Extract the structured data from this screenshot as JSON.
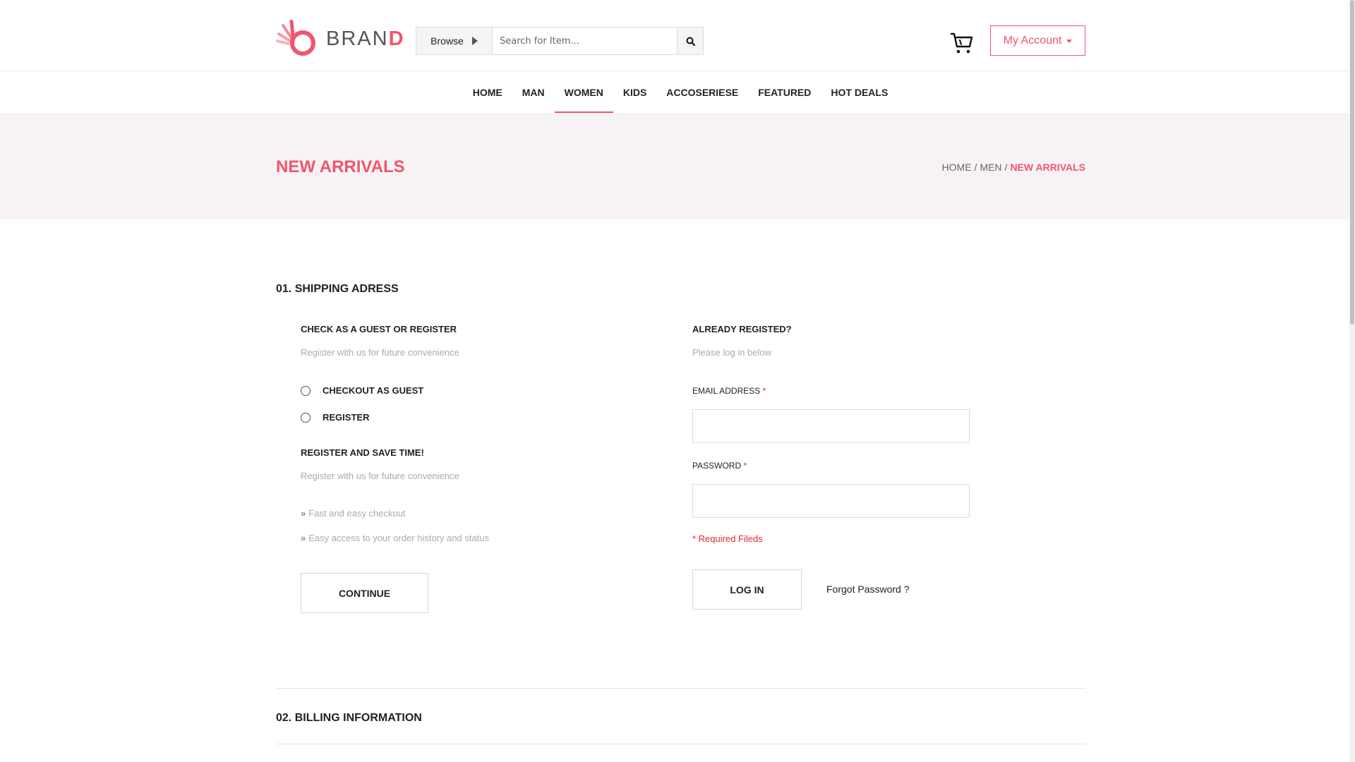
{
  "header": {
    "logo_text_main": "BRAN",
    "logo_text_accent": "D",
    "browse_label": "Browse",
    "search_placeholder": "Search for Item...",
    "account_label": "My Account"
  },
  "nav": {
    "items": [
      "HOME",
      "MAN",
      "WOMEN",
      "KIDS",
      "ACCOSERIESE",
      "FEATURED",
      "HOT DEALS"
    ],
    "active": "WOMEN"
  },
  "banner": {
    "title": "NEW ARRIVALS",
    "breadcrumb": [
      "HOME",
      "MEN",
      "NEW ARRIVALS"
    ]
  },
  "shipping": {
    "section_title": "01. SHIPPING ADRESS",
    "guest": {
      "heading": "CHECK AS A GUEST OR REGISTER",
      "subtext": "Register with us for future convenience",
      "options": [
        "CHECKOUT AS GUEST",
        "REGISTER"
      ],
      "register_heading": "REGISTER AND SAVE TIME!",
      "register_subtext": "Register with us for future convenience",
      "benefits": [
        "Fast and easy checkout",
        "Easy access to your order history and status"
      ],
      "continue_label": "CONTINUE"
    },
    "login": {
      "heading": "ALREADY REGISTED?",
      "subtext": "Please log in below",
      "email_label": "EMAIL ADDRESS",
      "password_label": "PASSWORD",
      "required_mark": "*",
      "required_note": "* Required Fileds",
      "login_label": "LOG IN",
      "forgot_label": "Forgot Password ?"
    }
  },
  "billing": {
    "section_title": "02. BILLING INFORMATION"
  },
  "colors": {
    "accent": "#f0566d",
    "banner_bg": "#f7f3f4",
    "required": "#e0282f"
  },
  "icons": [
    "logo-b-icon",
    "triangle-right-icon",
    "search-icon",
    "cart-icon",
    "caret-down-icon",
    "double-chevron-icon"
  ]
}
